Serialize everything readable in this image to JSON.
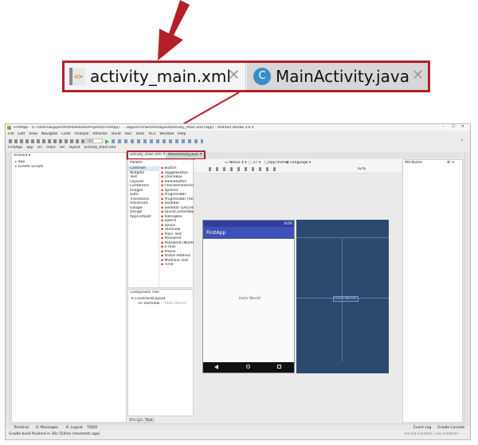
{
  "callout": {
    "tab1_label": "activity_main.xml",
    "tab1_icon_text": "<>",
    "tab2_icon_letter": "C",
    "tab2_label": "MainActivity.java"
  },
  "window": {
    "title": "FirstApp - [C:\\Users\\kupper\\AndroidStudioProjects\\FirstApp] - ...\\app\\src\\main\\res\\layout\\activity_main.xml [app] - Android Studio 3.0.1",
    "menu": [
      "File",
      "Edit",
      "View",
      "Navigate",
      "Code",
      "Analyze",
      "Refactor",
      "Build",
      "Run",
      "Tools",
      "VCS",
      "Window",
      "Help"
    ],
    "run_config": "app",
    "breadcrumbs": [
      "FirstApp",
      "app",
      "src",
      "main",
      "res",
      "layout",
      "activity_main.xml"
    ],
    "project_view": "Android",
    "project_items": [
      "app",
      "Gradle Scripts"
    ],
    "left_tools": [
      "1: Project",
      "7: Structure",
      "Captures",
      "2: Favorites",
      "Build Variants"
    ],
    "right_tools": [
      "Gradle",
      "Device File Explorer"
    ],
    "editor_tabs": [
      "activity_main.xml",
      "MainActivity.java"
    ],
    "palette_title": "Palette",
    "palette_categories": [
      "Common",
      "Widgets",
      "Text",
      "Layouts",
      "Containers",
      "Images",
      "Date",
      "Transitions",
      "Advanced",
      "Google",
      "Design",
      "AppCompat"
    ],
    "palette_items": [
      "Button",
      "ToggleButton",
      "CheckBox",
      "RadioButton",
      "CheckedTextView",
      "Spinner",
      "ProgressBar",
      "ProgressBar (Hor",
      "SeekBar",
      "SeekBar (Discret",
      "QuickContactBad",
      "RatingBar",
      "Switch",
      "Space",
      "TextView",
      "Plain Text",
      "Password",
      "Password (Nume",
      "E-mail",
      "Phone",
      "Postal Address",
      "Multiline Text",
      "Time"
    ],
    "toolbar_device": "Nexus 4",
    "toolbar_api": "27",
    "toolbar_theme": "AppTheme",
    "toolbar_language": "Language",
    "zoom": "62%",
    "attributes_title": "Attributes",
    "component_tree_title": "Component Tree",
    "tree_root": "ConstraintLayout",
    "tree_child": "TextView",
    "tree_child_value": "- \"Hello World!\"",
    "phone_time": "8:00",
    "app_title": "FirstApp",
    "hello_text": "Hello World!",
    "blueprint_text": "Hello World!",
    "bottom_tabs": [
      "Design",
      "Text"
    ],
    "bottom_tools": [
      "Terminal",
      "0: Messages",
      "6: Logcat",
      "TODO"
    ],
    "bottom_right_tools": [
      "Event Log",
      "Gradle Console"
    ],
    "status_text": "Gradle build finished in 36s 554ms (moments ago)",
    "status_right": "n/a  n/a  Context: <no context>"
  },
  "colors": {
    "callout_red": "#b3202a",
    "app_bar": "#3f51b5",
    "blueprint": "#2c4a6e",
    "phone_nav": "#111111"
  }
}
